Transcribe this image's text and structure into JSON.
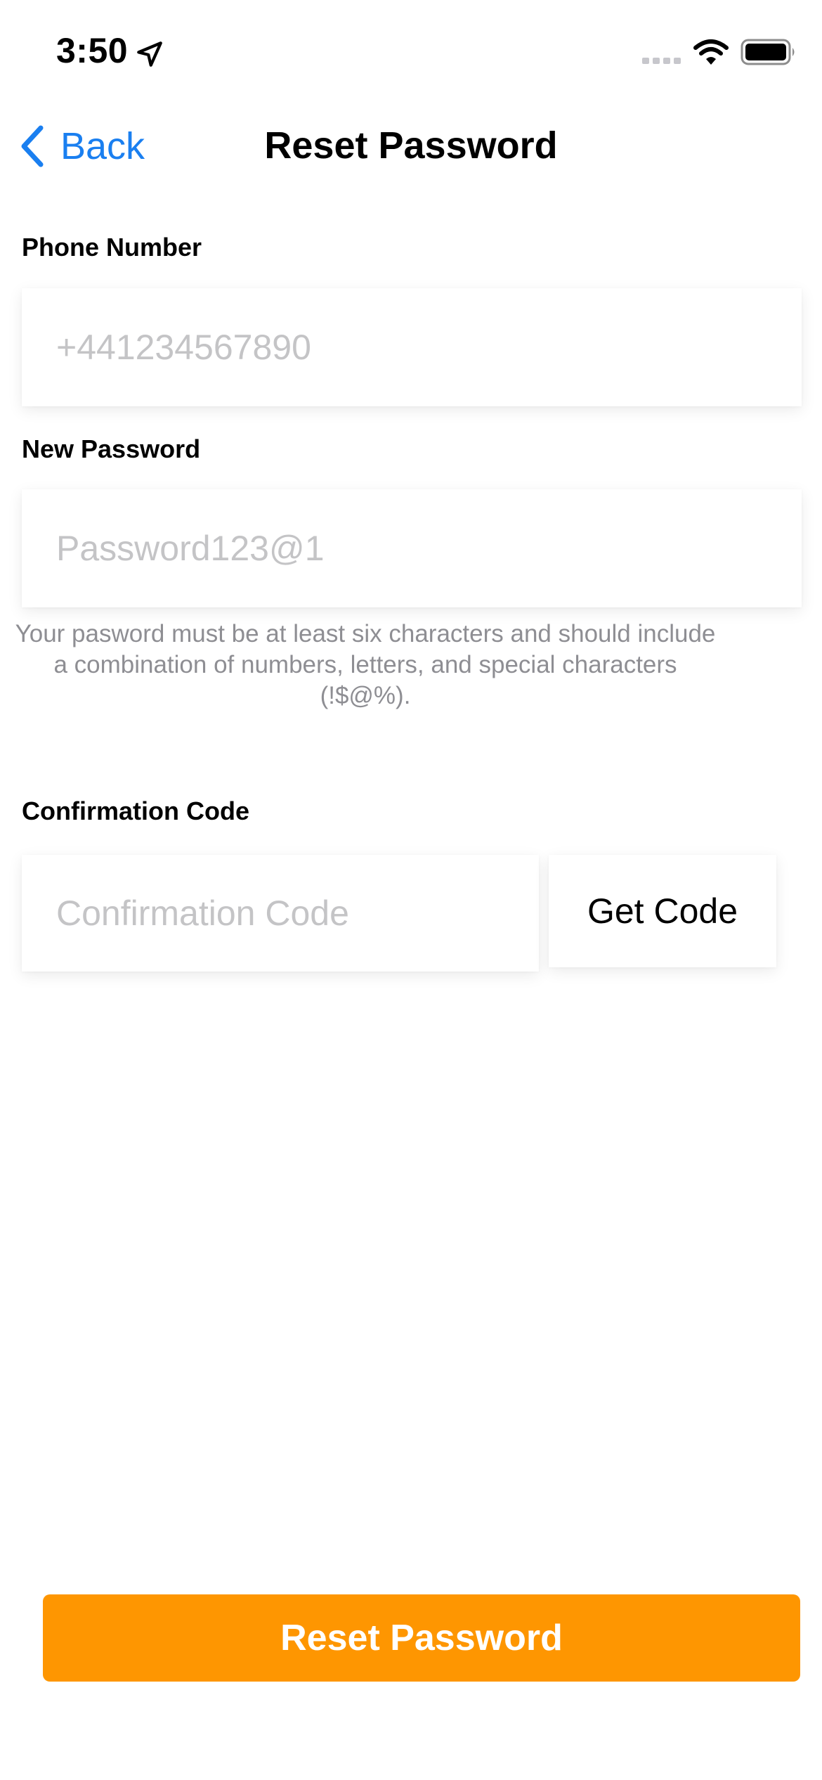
{
  "status_bar": {
    "time": "3:50",
    "icons": [
      "location-arrow-icon",
      "cellular-signal-icon",
      "wifi-icon",
      "battery-icon"
    ]
  },
  "nav": {
    "back_label": "Back",
    "title": "Reset Password",
    "accent_color": "#1a7ff0"
  },
  "form": {
    "phone": {
      "label": "Phone Number",
      "placeholder": "+441234567890",
      "value": ""
    },
    "password": {
      "label": "New Password",
      "placeholder": "Password123@1",
      "value": "",
      "hint": "Your pasword must be at least six characters and should include a combination of numbers, letters, and special characters (!$@%)."
    },
    "code": {
      "label": "Confirmation Code",
      "placeholder": "Confirmation Code",
      "value": "",
      "get_code_label": "Get Code"
    }
  },
  "submit": {
    "label": "Reset Password",
    "color": "#fe9601"
  }
}
